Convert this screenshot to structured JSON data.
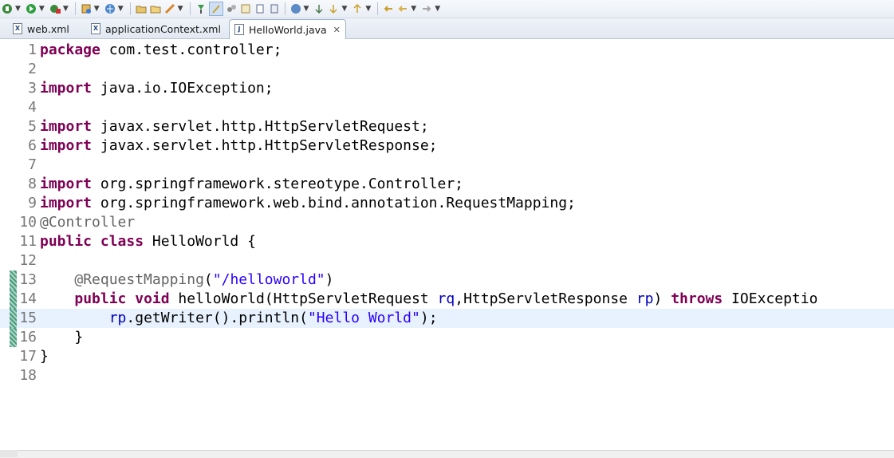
{
  "tabs": [
    {
      "label": "web.xml",
      "icon": "xml-file-icon",
      "active": false
    },
    {
      "label": "applicationContext.xml",
      "icon": "xml-file-icon",
      "active": false
    },
    {
      "label": "HelloWorld.java",
      "icon": "java-file-icon",
      "active": true
    }
  ],
  "toolbar_icons": [
    "debug-icon",
    "run-icon",
    "external-tools-icon",
    "new-server-icon",
    "web-browser-icon",
    "open-type-icon",
    "open-task-icon",
    "search-icon",
    "toggle-markers-icon",
    "annotations-icon",
    "next-edit-icon",
    "previous-edit-icon",
    "back-icon",
    "forward-icon"
  ],
  "editor": {
    "lines": [
      {
        "n": "1",
        "tokens": [
          {
            "t": "package",
            "c": "kw"
          },
          {
            "t": " com.test.controller;",
            "c": ""
          }
        ]
      },
      {
        "n": "2",
        "tokens": []
      },
      {
        "n": "3",
        "tokens": [
          {
            "t": "import",
            "c": "kw"
          },
          {
            "t": " java.io.IOException;",
            "c": ""
          }
        ]
      },
      {
        "n": "4",
        "tokens": []
      },
      {
        "n": "5",
        "tokens": [
          {
            "t": "import",
            "c": "kw"
          },
          {
            "t": " javax.servlet.http.HttpServletRequest;",
            "c": ""
          }
        ]
      },
      {
        "n": "6",
        "tokens": [
          {
            "t": "import",
            "c": "kw"
          },
          {
            "t": " javax.servlet.http.HttpServletResponse;",
            "c": ""
          }
        ]
      },
      {
        "n": "7",
        "tokens": []
      },
      {
        "n": "8",
        "tokens": [
          {
            "t": "import",
            "c": "kw"
          },
          {
            "t": " org.springframework.stereotype.Controller;",
            "c": ""
          }
        ]
      },
      {
        "n": "9",
        "tokens": [
          {
            "t": "import",
            "c": "kw"
          },
          {
            "t": " org.springframework.web.bind.annotation.RequestMapping;",
            "c": ""
          }
        ]
      },
      {
        "n": "10",
        "tokens": [
          {
            "t": "@Controller",
            "c": "ann"
          }
        ]
      },
      {
        "n": "11",
        "tokens": [
          {
            "t": "public",
            "c": "kw"
          },
          {
            "t": " ",
            "c": ""
          },
          {
            "t": "class",
            "c": "kw"
          },
          {
            "t": " HelloWorld {",
            "c": ""
          }
        ]
      },
      {
        "n": "12",
        "tokens": []
      },
      {
        "n": "13",
        "tokens": [
          {
            "t": "    ",
            "c": ""
          },
          {
            "t": "@RequestMapping",
            "c": "ann"
          },
          {
            "t": "(",
            "c": ""
          },
          {
            "t": "\"/helloworld\"",
            "c": "str"
          },
          {
            "t": ")",
            "c": ""
          }
        ]
      },
      {
        "n": "14",
        "tokens": [
          {
            "t": "    ",
            "c": ""
          },
          {
            "t": "public",
            "c": "kw"
          },
          {
            "t": " ",
            "c": ""
          },
          {
            "t": "void",
            "c": "kw"
          },
          {
            "t": " helloWorld(HttpServletRequest ",
            "c": ""
          },
          {
            "t": "rq",
            "c": "fld"
          },
          {
            "t": ",HttpServletResponse ",
            "c": ""
          },
          {
            "t": "rp",
            "c": "fld"
          },
          {
            "t": ") ",
            "c": ""
          },
          {
            "t": "throws",
            "c": "kw"
          },
          {
            "t": " IOExceptio",
            "c": ""
          }
        ]
      },
      {
        "n": "15",
        "tokens": [
          {
            "t": "        ",
            "c": ""
          },
          {
            "t": "rp",
            "c": "fld"
          },
          {
            "t": ".getWriter().println(",
            "c": ""
          },
          {
            "t": "\"Hello World\"",
            "c": "str"
          },
          {
            "t": ");",
            "c": ""
          }
        ]
      },
      {
        "n": "16",
        "tokens": [
          {
            "t": "    }",
            "c": ""
          }
        ]
      },
      {
        "n": "17",
        "tokens": [
          {
            "t": "}",
            "c": ""
          }
        ]
      },
      {
        "n": "18",
        "tokens": []
      }
    ],
    "current_line": "15",
    "changed_lines": [
      "13",
      "14",
      "15",
      "16"
    ]
  }
}
